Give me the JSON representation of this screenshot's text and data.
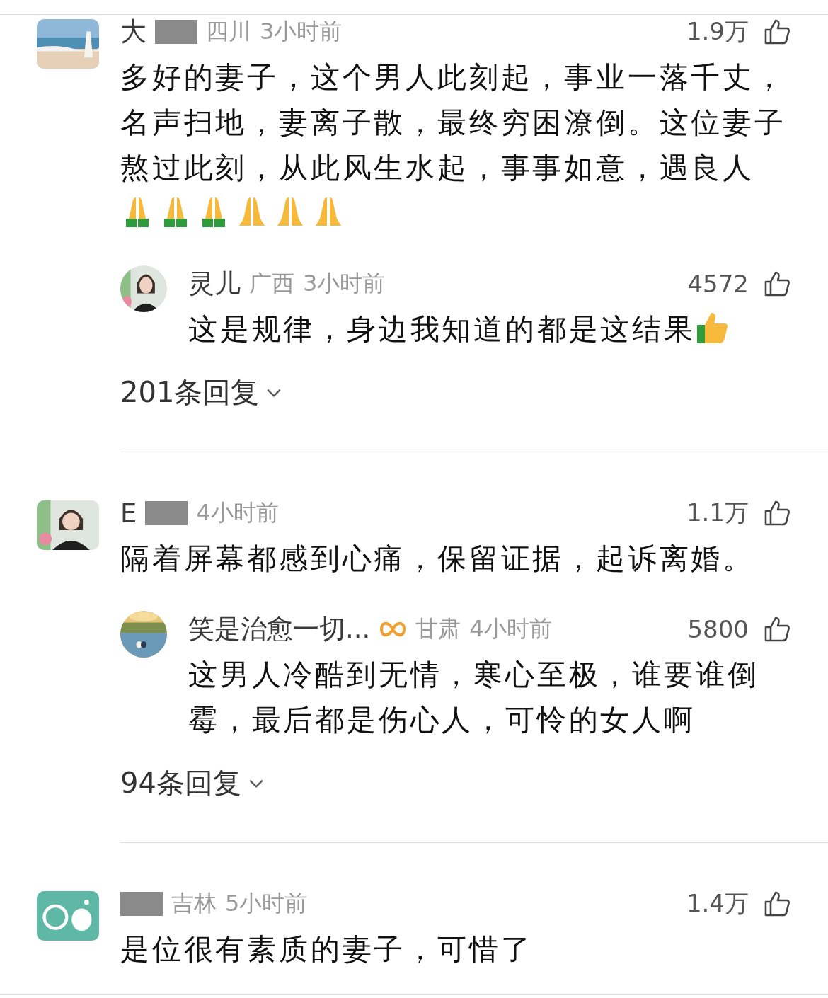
{
  "comments": [
    {
      "name": "大",
      "redacted": true,
      "location": "四川",
      "time": "3小时前",
      "likes": "1.9万",
      "text": "多好的妻子，这个男人此刻起，事业一落千丈，名声扫地，妻离子散，最终穷困潦倒。这位妻子熬过此刻，从此风生水起，事事如意，遇良人",
      "emojis": [
        {
          "kind": "pray-green"
        },
        {
          "kind": "pray-green"
        },
        {
          "kind": "pray-green"
        },
        {
          "kind": "pray-yellow"
        },
        {
          "kind": "pray-yellow"
        },
        {
          "kind": "pray-yellow"
        }
      ],
      "reply": {
        "name": "灵儿",
        "location": "广西",
        "time": "3小时前",
        "likes": "4572",
        "text": "这是规律，身边我知道的都是这结果",
        "emojis": [
          {
            "kind": "thumbs-up"
          }
        ]
      },
      "reply_count": "201条回复"
    },
    {
      "name": "E",
      "redacted": true,
      "time": "4小时前",
      "likes": "1.1万",
      "text": "隔着屏幕都感到心痛，保留证据，起诉离婚。",
      "reply": {
        "name": "笑是治愈一切...",
        "badge": true,
        "location": "甘肃",
        "time": "4小时前",
        "likes": "5800",
        "text": "这男人冷酷到无情，寒心至极，谁要谁倒霉，最后都是伤心人，可怜的女人啊"
      },
      "reply_count": "94条回复"
    },
    {
      "redacted": true,
      "location": "吉林",
      "time": "5小时前",
      "likes": "1.4万",
      "text": "是位很有素质的妻子，可惜了"
    }
  ]
}
